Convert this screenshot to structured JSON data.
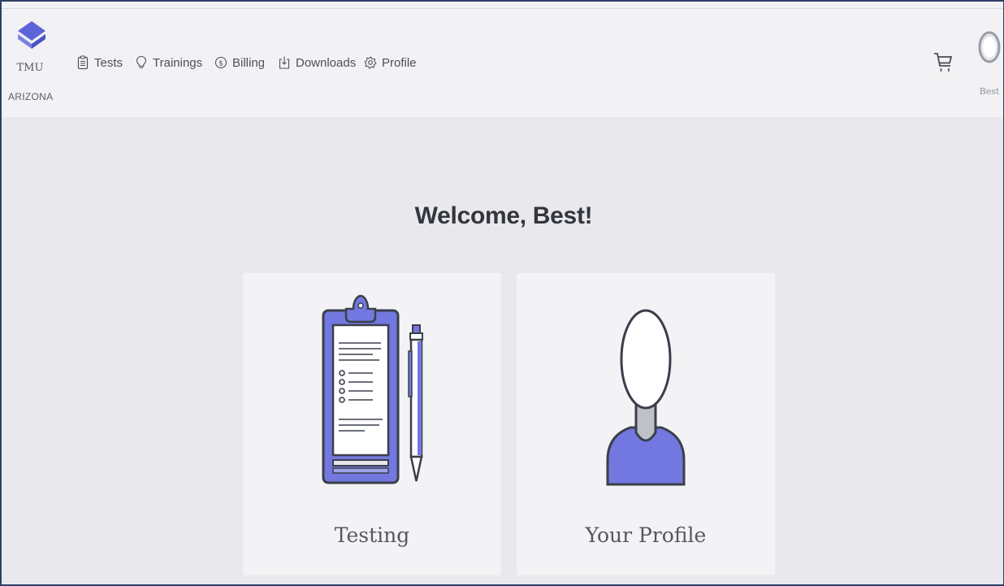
{
  "brand": {
    "name_line1": "TMU",
    "name_line2": "ARIZONA",
    "logo_icon": "graduation-cap-diamond-icon",
    "logo_color": "#5b65d9"
  },
  "nav": {
    "items": [
      {
        "label": "Tests",
        "icon": "clipboard-icon"
      },
      {
        "label": "Trainings",
        "icon": "lightbulb-icon"
      },
      {
        "label": "Billing",
        "icon": "dollar-circle-icon"
      },
      {
        "label": "Downloads",
        "icon": "download-icon"
      },
      {
        "label": "Profile",
        "icon": "gear-icon"
      }
    ]
  },
  "header_right": {
    "cart_icon": "cart-icon",
    "user_name": "Best",
    "avatar_icon": "user-avatar-icon"
  },
  "main": {
    "welcome": "Welcome, Best!",
    "cards": [
      {
        "label": "Testing",
        "icon": "clipboard-pen-illustration"
      },
      {
        "label": "Your Profile",
        "icon": "person-bust-illustration"
      }
    ]
  },
  "colors": {
    "accent": "#7378e0",
    "outline": "#3b3f4a",
    "page_bg": "#e9e9ed",
    "header_bg": "#f2f2f4"
  }
}
